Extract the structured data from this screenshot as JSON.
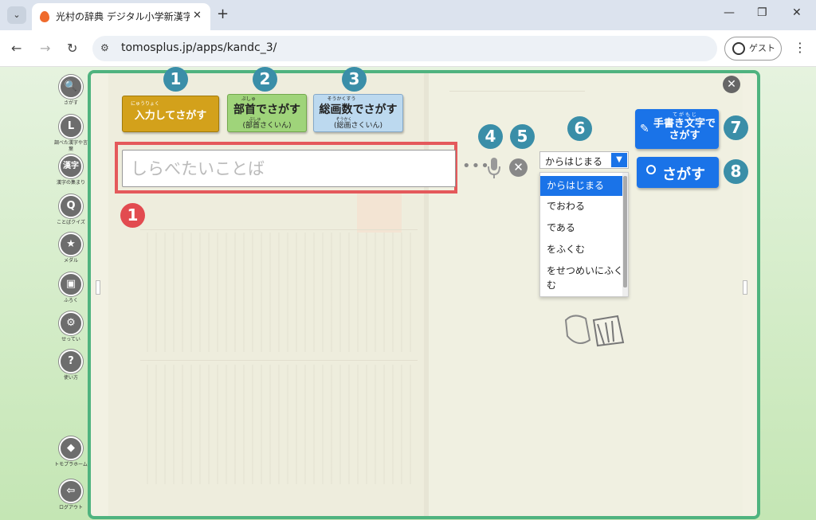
{
  "browser": {
    "tab_title": "光村の辞典 デジタル小学新漢字辞典",
    "url": "tomosplus.jp/apps/kandc_3/",
    "profile_label": "ゲスト"
  },
  "sidebar": {
    "items": [
      {
        "icon": "search-icon",
        "glyph": "🔍",
        "label": "さがす"
      },
      {
        "icon": "clock-icon",
        "glyph": "L",
        "label": "調べた漢字や言葉"
      },
      {
        "icon": "kanji-icon",
        "glyph": "漢字",
        "label": "漢字の集まり"
      },
      {
        "icon": "quiz-icon",
        "glyph": "Q",
        "label": "ことばクイズ"
      },
      {
        "icon": "medal-icon",
        "glyph": "★",
        "label": "メダル"
      },
      {
        "icon": "gift-icon",
        "glyph": "▣",
        "label": "ふろく"
      },
      {
        "icon": "settings-icon",
        "glyph": "⚙",
        "label": "せってい"
      },
      {
        "icon": "help-icon",
        "glyph": "?",
        "label": "使い方"
      },
      {
        "icon": "home-icon",
        "glyph": "◆",
        "label": "トモプラホーム"
      },
      {
        "icon": "logout-icon",
        "glyph": "⇦",
        "label": "ログアウト"
      }
    ]
  },
  "search_modes": {
    "input": {
      "ruby": "にゅうりょく",
      "label": "入力してさがす",
      "badge": "1"
    },
    "bushu": {
      "ruby": "ぶしゅ",
      "label": "部首でさがす",
      "sub_ruby": "ぶしゅ",
      "sub": "(部首さくいん)",
      "badge": "2"
    },
    "kakusu": {
      "ruby": "そうかくすう",
      "label": "総画数でさがす",
      "sub_ruby": "そうかく",
      "sub": "(総画さくいん)",
      "badge": "3"
    }
  },
  "search": {
    "placeholder": "しらべたいことば",
    "value": "",
    "badge_main": "1",
    "badge_mic": "4",
    "badge_clear": "5"
  },
  "match_dropdown": {
    "selected": "からはじまる",
    "badge": "6",
    "options": [
      "からはじまる",
      "でおわる",
      "である",
      "をふくむ",
      "をせつめいにふくむ"
    ]
  },
  "handwriting_button": {
    "ruby": "て が   も じ",
    "label": "手書き文字でさがす",
    "badge": "7"
  },
  "search_button": {
    "label": "さがす",
    "badge": "8"
  },
  "colors": {
    "accent": "#1a73e8",
    "book_border": "#4fb37f",
    "badge": "#3a8ea8",
    "badge_red": "#e24b50"
  }
}
